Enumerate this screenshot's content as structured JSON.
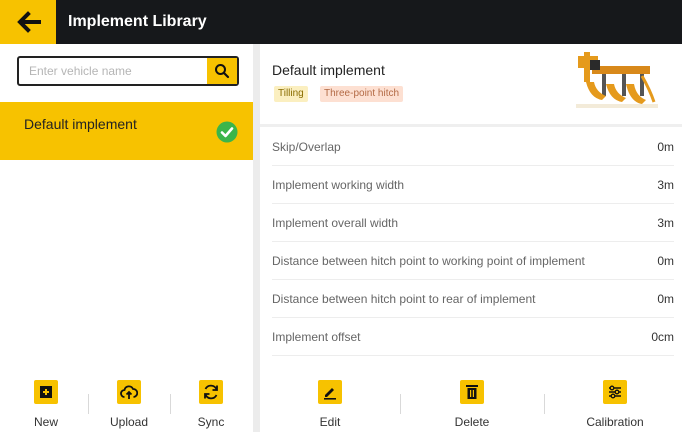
{
  "header": {
    "title": "Implement Library"
  },
  "search": {
    "placeholder": "Enter vehicle name",
    "value": ""
  },
  "vehicle_list": {
    "items": [
      {
        "label": "Default implement",
        "selected": true
      }
    ]
  },
  "left_toolbar": {
    "new_label": "New",
    "upload_label": "Upload",
    "sync_label": "Sync"
  },
  "implement": {
    "name": "Default implement",
    "tags": [
      "Tilling",
      "Three-point hitch"
    ],
    "params": [
      {
        "label": "Skip/Overlap",
        "value": "0m"
      },
      {
        "label": "Implement working width",
        "value": "3m"
      },
      {
        "label": "Implement overall width",
        "value": "3m"
      },
      {
        "label": "Distance between hitch point to working point of implement",
        "value": "0m"
      },
      {
        "label": "Distance between hitch point to rear of implement",
        "value": "0m"
      },
      {
        "label": "Implement offset",
        "value": "0cm"
      }
    ]
  },
  "right_toolbar": {
    "edit_label": "Edit",
    "delete_label": "Delete",
    "calibration_label": "Calibration"
  },
  "colors": {
    "accent": "#f7c200",
    "header_bg": "#16181b",
    "check": "#3bb54a"
  }
}
